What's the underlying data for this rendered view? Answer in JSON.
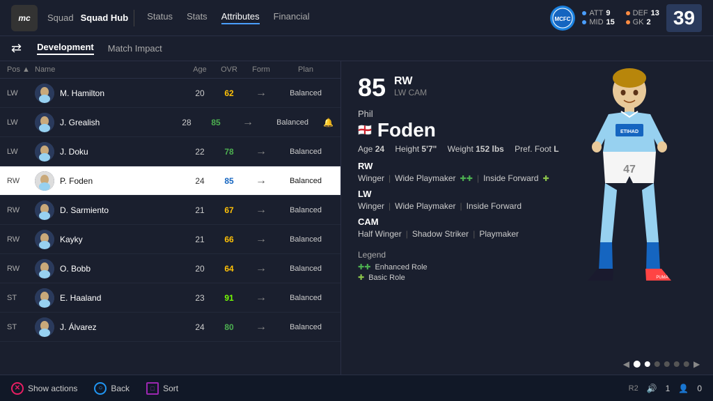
{
  "app": {
    "logo": "mc",
    "nav_left": "Squad",
    "nav_title": "Squad Hub",
    "tabs": [
      "Status",
      "Stats",
      "Attributes",
      "Financial"
    ],
    "active_tab": "Attributes"
  },
  "club_stats": {
    "att": 9,
    "def": 13,
    "mid": 15,
    "gk": 2,
    "total": 39
  },
  "sub_tabs": [
    "Development",
    "Match Impact"
  ],
  "active_sub_tab": "Development",
  "list_headers": {
    "pos": "Pos ▲",
    "name": "Name",
    "age": "Age",
    "ovr": "OVR",
    "form": "Form",
    "plan": "Plan"
  },
  "players": [
    {
      "pos": "LW",
      "name": "M. Hamilton",
      "age": 20,
      "ovr": 62,
      "ovr_class": "ovr-yellow",
      "form": "→",
      "plan": "Balanced",
      "icon": ""
    },
    {
      "pos": "LW",
      "name": "J. Grealish",
      "age": 28,
      "ovr": 85,
      "ovr_class": "ovr-green",
      "form": "→",
      "plan": "Balanced",
      "icon": "🔔"
    },
    {
      "pos": "LW",
      "name": "J. Doku",
      "age": 22,
      "ovr": 78,
      "ovr_class": "ovr-green",
      "form": "→",
      "plan": "Balanced",
      "icon": ""
    },
    {
      "pos": "RW",
      "name": "P. Foden",
      "age": 24,
      "ovr": 85,
      "ovr_class": "ovr-green",
      "form": "→",
      "plan": "Balanced",
      "icon": "",
      "selected": true
    },
    {
      "pos": "RW",
      "name": "D. Sarmiento",
      "age": 21,
      "ovr": 67,
      "ovr_class": "ovr-yellow",
      "form": "→",
      "plan": "Balanced",
      "icon": ""
    },
    {
      "pos": "RW",
      "name": "Kayky",
      "age": 21,
      "ovr": 66,
      "ovr_class": "ovr-yellow",
      "form": "→",
      "plan": "Balanced",
      "icon": ""
    },
    {
      "pos": "RW",
      "name": "O. Bobb",
      "age": 20,
      "ovr": 64,
      "ovr_class": "ovr-yellow",
      "form": "→",
      "plan": "Balanced",
      "icon": ""
    },
    {
      "pos": "ST",
      "name": "E. Haaland",
      "age": 23,
      "ovr": 91,
      "ovr_class": "ovr-bright-green",
      "form": "→",
      "plan": "Balanced",
      "icon": ""
    },
    {
      "pos": "ST",
      "name": "J. Álvarez",
      "age": 24,
      "ovr": 80,
      "ovr_class": "ovr-green",
      "form": "→",
      "plan": "Balanced",
      "icon": ""
    }
  ],
  "selected_player": {
    "ovr": 85,
    "pos_main": "RW",
    "pos_alts": "LW  CAM",
    "first_name": "Phil",
    "last_name": "Foden",
    "flag": "🏴󠁧󠁢󠁥󠁮󠁧󠁿",
    "age": 24,
    "height": "5'7\"",
    "weight": "152 lbs",
    "pref_foot": "L",
    "roles": {
      "RW": {
        "roles": [
          "Winger",
          "Wide Playmaker ✚✚",
          "Inside Forward ✚"
        ]
      },
      "LW": {
        "roles": [
          "Winger",
          "Wide Playmaker",
          "Inside Forward"
        ]
      },
      "CAM": {
        "roles": [
          "Half Winger",
          "Shadow Striker",
          "Playmaker"
        ]
      }
    },
    "legend": {
      "title": "Legend",
      "enhanced": "Enhanced Role",
      "basic": "Basic Role"
    }
  },
  "pagination": {
    "dots": 6,
    "active": 1
  },
  "bottom_bar": {
    "show_actions": "Show actions",
    "back": "Back",
    "sort": "Sort"
  },
  "bottom_right": {
    "r2": "R2",
    "vol": "1",
    "players_count": "0"
  }
}
